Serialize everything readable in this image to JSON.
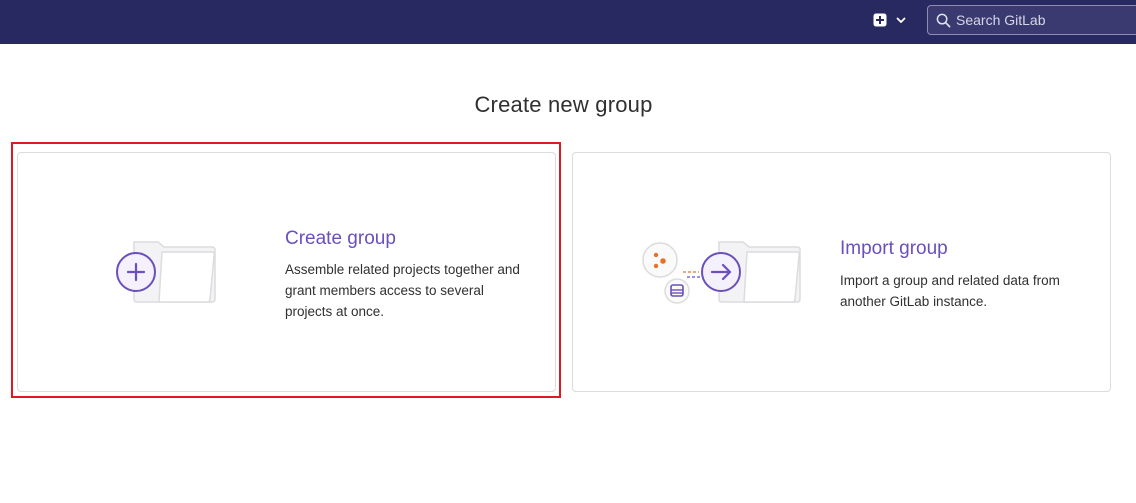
{
  "header": {
    "new_menu_icon": "plus-square-icon",
    "new_menu_chevron_icon": "chevron-down-icon",
    "search": {
      "icon": "search-icon",
      "placeholder": "Search GitLab"
    },
    "background_color": "#292961"
  },
  "page": {
    "title": "Create new group"
  },
  "panels": [
    {
      "title": "Create group",
      "description": "Assemble related projects together and grant members access to several projects at once.",
      "icon": "plus-circle-icon",
      "illustration": "folder-icon",
      "selected": true
    },
    {
      "title": "Import group",
      "description": "Import a group and related data from another GitLab instance.",
      "icon": "arrow-right-circle-icon",
      "illustration": "folder-icon",
      "source_icons": [
        "gitlab-instance-icon",
        "database-icon"
      ]
    }
  ],
  "colors": {
    "accent": "#6b4fbb",
    "selection_outline": "#e0191f",
    "accent_orange": "#e9702a"
  }
}
